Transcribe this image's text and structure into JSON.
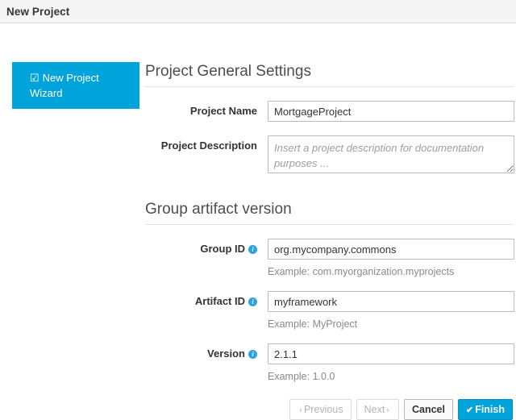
{
  "window": {
    "title": "New Project"
  },
  "sidebar": {
    "items": [
      {
        "icon": "checked-box-icon",
        "icon_glyph": "☑",
        "label": "New Project Wizard",
        "active": true
      }
    ]
  },
  "main": {
    "sections": [
      {
        "heading": "Project General Settings",
        "fields": [
          {
            "label": "Project Name",
            "type": "input",
            "value": "MortgageProject",
            "placeholder": "",
            "hint": "",
            "has_info": false
          },
          {
            "label": "Project Description",
            "type": "textarea",
            "value": "",
            "placeholder": "Insert a project description for documentation purposes ...",
            "hint": "",
            "has_info": false
          }
        ]
      },
      {
        "heading": "Group artifact version",
        "fields": [
          {
            "label": "Group ID",
            "type": "input",
            "value": "org.mycompany.commons",
            "placeholder": "",
            "hint": "Example: com.myorganization.myprojects",
            "has_info": true
          },
          {
            "label": "Artifact ID",
            "type": "input",
            "value": "myframework",
            "placeholder": "",
            "hint": "Example: MyProject",
            "has_info": true
          },
          {
            "label": "Version",
            "type": "input",
            "value": "2.1.1",
            "placeholder": "",
            "hint": "Example: 1.0.0",
            "has_info": true
          }
        ]
      }
    ]
  },
  "buttons": {
    "previous": {
      "label": "Previous",
      "chevron": "‹",
      "disabled": true
    },
    "next": {
      "label": "Next",
      "chevron": "›",
      "disabled": true
    },
    "cancel": {
      "label": "Cancel",
      "disabled": false
    },
    "finish": {
      "label": "Finish",
      "check": "✔",
      "disabled": false
    }
  },
  "icons": {
    "info": "i"
  },
  "colors": {
    "accent": "#00a3da",
    "header_bg": "#f5f5f5",
    "info_icon": "#2fa3db",
    "hint_text": "#8a8a8a",
    "border": "#bcbcbc"
  }
}
